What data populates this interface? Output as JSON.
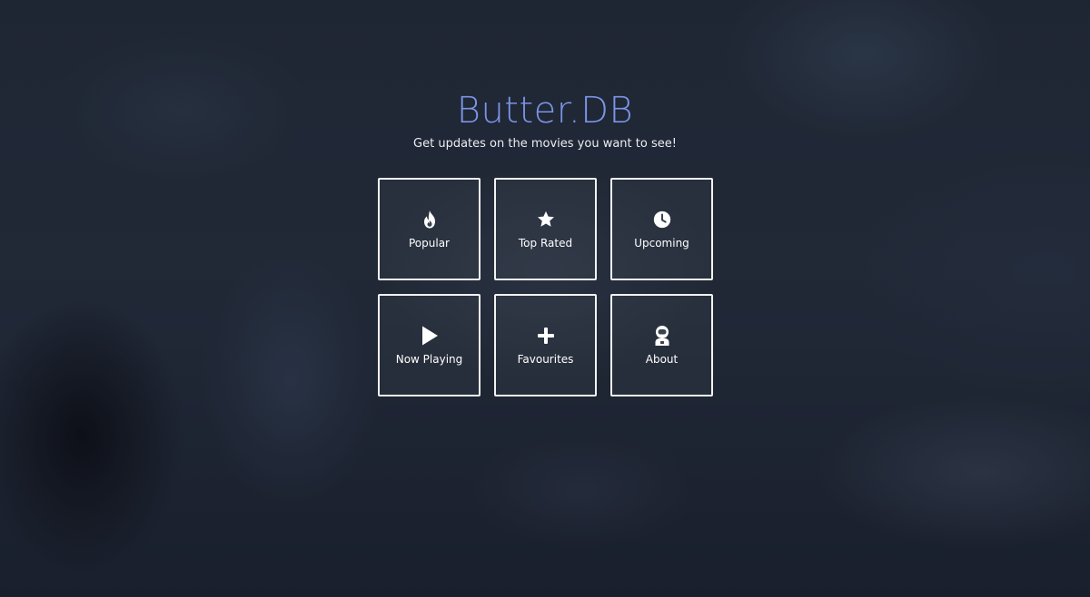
{
  "app": {
    "title": "Butter.DB",
    "tagline": "Get updates on the movies you want to see!",
    "accent_color": "#7b94e6"
  },
  "menu": [
    {
      "label": "Popular",
      "icon": "flame-icon"
    },
    {
      "label": "Top Rated",
      "icon": "star-icon"
    },
    {
      "label": "Upcoming",
      "icon": "clock-icon"
    },
    {
      "label": "Now Playing",
      "icon": "play-icon"
    },
    {
      "label": "Favourites",
      "icon": "plus-icon"
    },
    {
      "label": "About",
      "icon": "astronaut-icon"
    }
  ]
}
